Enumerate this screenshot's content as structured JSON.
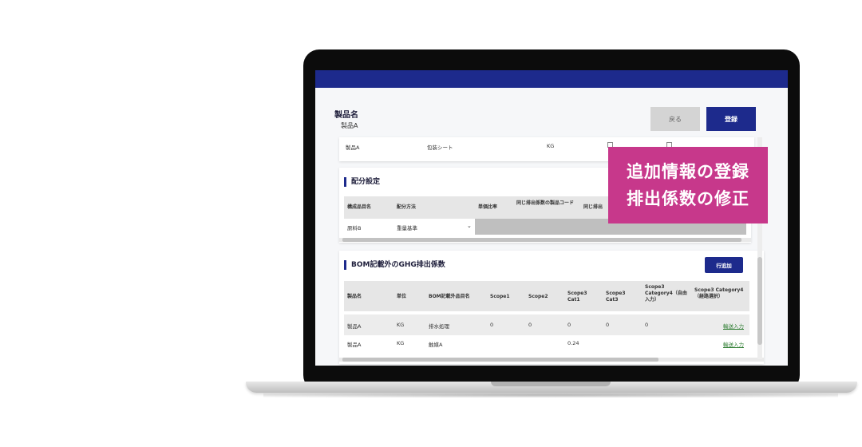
{
  "page": {
    "product_label": "製品名",
    "product_value": "製品A",
    "back_button": "戻る",
    "register_button": "登録"
  },
  "top_row": {
    "col1": "製品A",
    "col2": "包装シート",
    "col3": "KG"
  },
  "allocation": {
    "title": "配分設定",
    "headers": [
      "構成品目名",
      "配分方法",
      "単価比率",
      "同じ排出係数の製品コード",
      "同じ排出"
    ],
    "row": {
      "component": "原料B",
      "method": "重量基準"
    }
  },
  "ghg": {
    "title": "BOM記載外のGHG排出係数",
    "add_row_button": "行追加",
    "headers": [
      "製品名",
      "単位",
      "BOM記載外品目名",
      "Scope1",
      "Scope2",
      "Scope3 Cat1",
      "Scope3 Cat3",
      "Scope3 Category4（自由入力）",
      "Scope3 Category4（経路選択）"
    ],
    "rows": [
      {
        "product": "製品A",
        "unit": "KG",
        "item": "排水処理",
        "scope1": "0",
        "scope2": "0",
        "cat1": "0",
        "cat3": "0",
        "cat4_free": "0",
        "link": "輸送入力"
      },
      {
        "product": "製品A",
        "unit": "KG",
        "item": "触媒A",
        "scope1": "",
        "scope2": "",
        "cat1": "0.24",
        "cat3": "",
        "cat4_free": "",
        "link": "輸送入力"
      }
    ]
  },
  "callout": {
    "line1": "追加情報の登録",
    "line2": "排出係数の修正"
  },
  "colors": {
    "brand": "#1d2a8c",
    "callout": "#c7388b",
    "link": "#2e7d32"
  }
}
